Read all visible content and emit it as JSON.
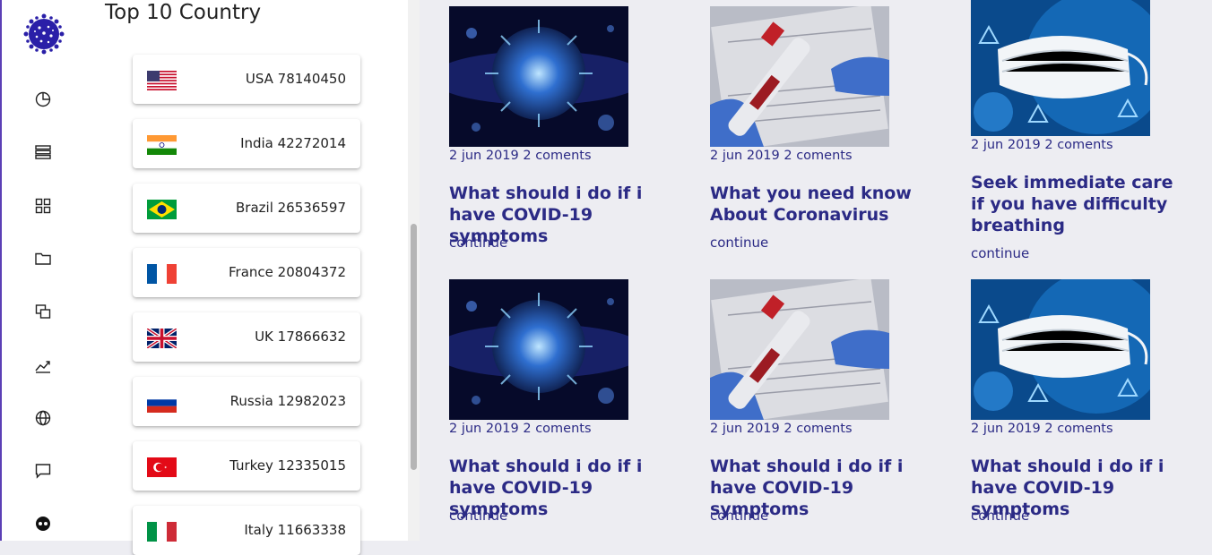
{
  "sidebar": {
    "logo_icon": "virus-logo-icon",
    "nav_icons": [
      "pie-chart-icon",
      "list-icon",
      "grid-icon",
      "folder-icon",
      "copy-icon",
      "trend-chart-icon",
      "globe-icon",
      "chat-icon",
      "user-circle-icon"
    ],
    "accent": "#5b3fb5",
    "logo_color": "#2a1fa8"
  },
  "countries_panel": {
    "title": "Top 10 Country",
    "countries": [
      {
        "label": "USA 78140450",
        "flag": "us-flag-icon"
      },
      {
        "label": "India 42272014",
        "flag": "india-flag-icon"
      },
      {
        "label": "Brazil 26536597",
        "flag": "brazil-flag-icon"
      },
      {
        "label": "France 20804372",
        "flag": "france-flag-icon"
      },
      {
        "label": "UK 17866632",
        "flag": "uk-flag-icon"
      },
      {
        "label": "Russia 12982023",
        "flag": "russia-flag-icon"
      },
      {
        "label": "Turkey 12335015",
        "flag": "turkey-flag-icon"
      },
      {
        "label": "Italy 11663338",
        "flag": "italy-flag-icon"
      }
    ]
  },
  "articles": [
    {
      "image": "virus-image",
      "meta": "2 jun 2019 2 coments",
      "title": "What should i do if i have COVID-19 symptoms",
      "link": "continue"
    },
    {
      "image": "test-tube-image",
      "meta": "2 jun 2019 2 coments",
      "title": "What you need know About Coronavirus",
      "link": "continue"
    },
    {
      "image": "mask-image",
      "meta": "2 jun 2019 2 coments",
      "title": "Seek immediate care if you have difficulty breathing",
      "link": "continue"
    },
    {
      "image": "virus-image",
      "meta": "2 jun 2019 2 coments",
      "title": "What should i do if i have COVID-19 symptoms",
      "link": "continue"
    },
    {
      "image": "test-tube-image",
      "meta": "2 jun 2019 2 coments",
      "title": "What should i do if i have COVID-19 symptoms",
      "link": "continue"
    },
    {
      "image": "mask-image",
      "meta": "2 jun 2019 2 coments",
      "title": "What should i do if i have COVID-19 symptoms",
      "link": "continue"
    }
  ],
  "colors": {
    "article_text": "#2b2a85",
    "main_bg": "#ededf2"
  }
}
